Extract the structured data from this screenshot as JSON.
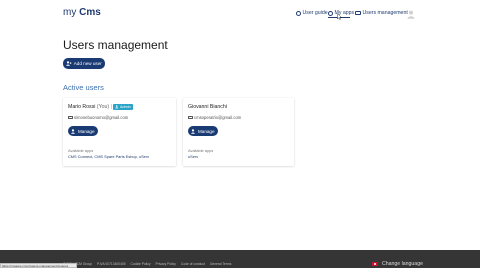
{
  "header": {
    "logo_prefix": "my",
    "logo_brand": "Cms",
    "nav": {
      "user_guide": "User guide",
      "my_apps": "My apps",
      "users_management": "Users management"
    }
  },
  "main": {
    "title": "Users management",
    "add_user_label": "Add new user",
    "section_title": "Active users",
    "users": [
      {
        "name": "Mario Rossi",
        "you": "(You)",
        "badge": "Admin",
        "email": "simonebuonomo@gmail.com",
        "manage_label": "Manage",
        "available_label": "Available apps",
        "apps": "CMS Connect, CMS Spare Parts Eshop, uServ"
      },
      {
        "name": "Giovanni Bianchi",
        "email": "cmsoperatrix@gmail.com",
        "manage_label": "Manage",
        "available_label": "Available apps",
        "apps": "uServ"
      }
    ]
  },
  "footer": {
    "links": [
      "© 2024 SCM Group",
      "P.IVA 00713400405",
      "Cookie Policy",
      "Privacy Policy",
      "Code of conduct",
      "General Terms"
    ],
    "language_label": "Change language"
  },
  "statusbar": {
    "url": "https://myapps.cms.it/users-management/myapps"
  },
  "colors": {
    "brand": "#1a3a73",
    "accent": "#3a6fb0",
    "badge": "#29a3c8",
    "footer": "#353535"
  }
}
